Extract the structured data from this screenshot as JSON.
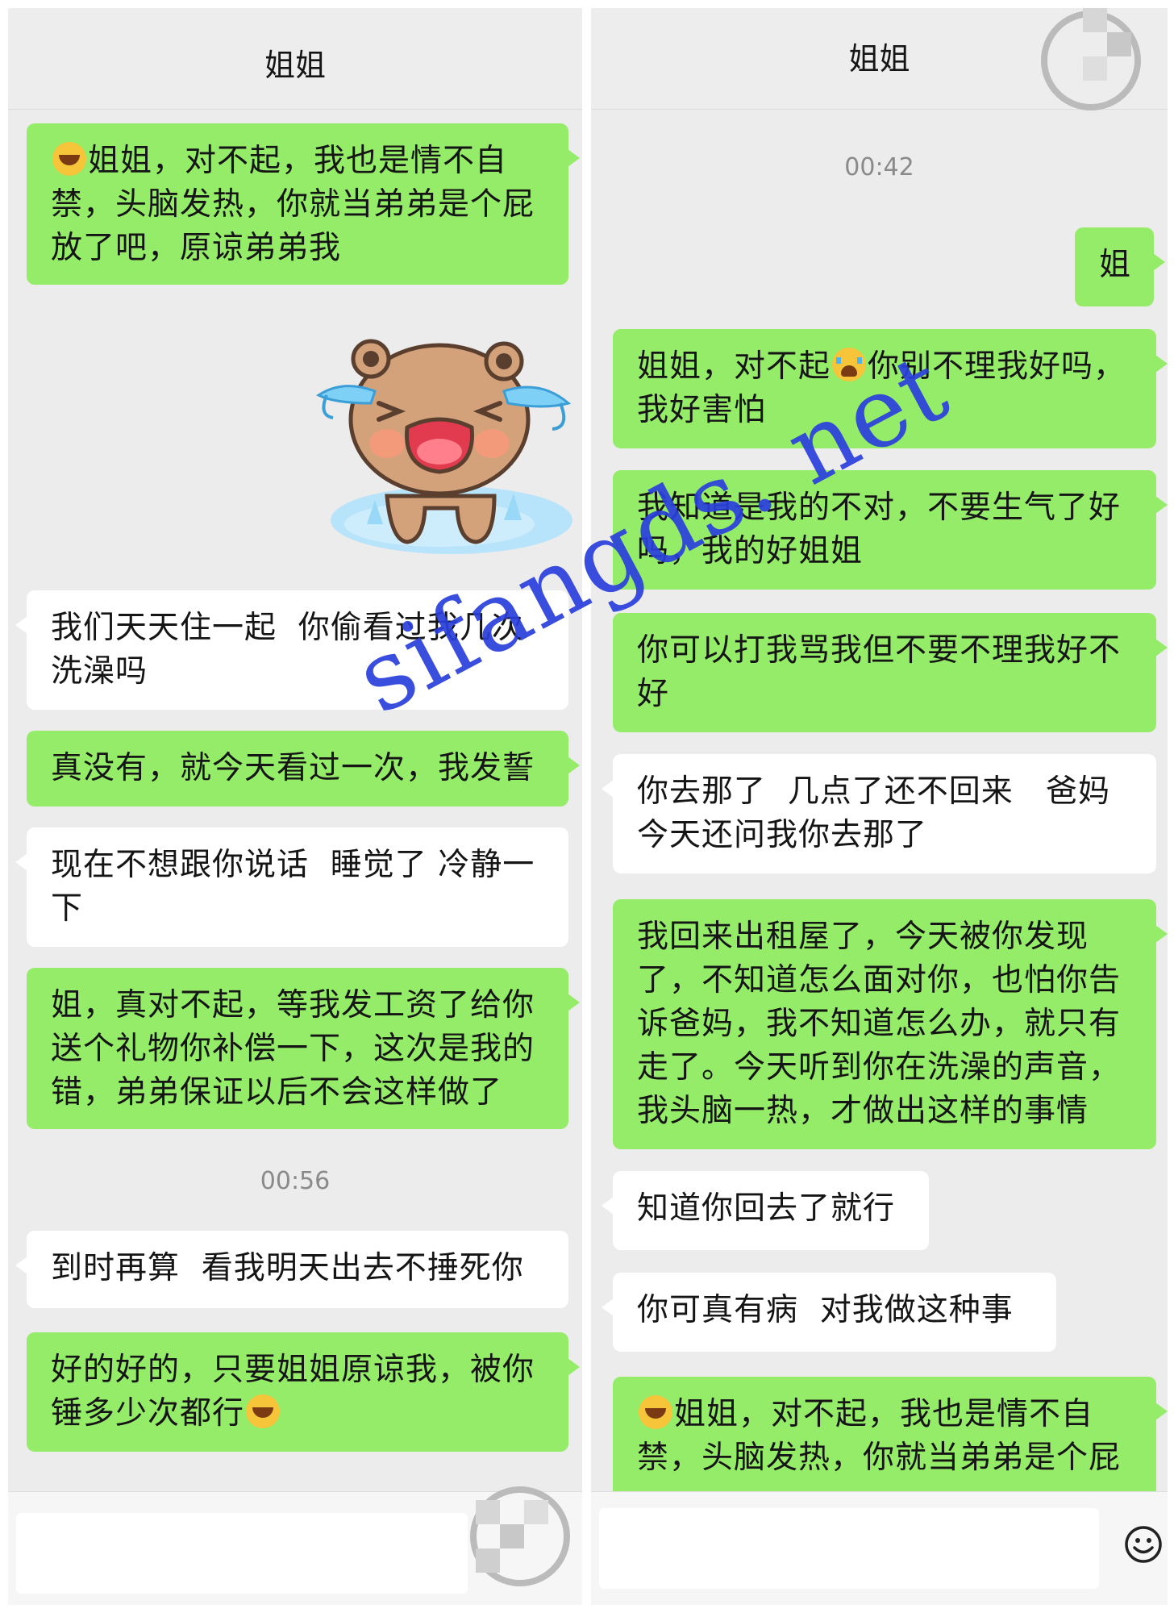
{
  "left": {
    "header_title": "姐姐",
    "messages": [
      {
        "side": "sent",
        "emoji_start": "laugh-cry",
        "text": "姐姐，对不起，我也是情不自\n禁，头脑发热，你就当弟弟是个屁\n放了吧，原谅弟弟我"
      },
      {
        "side": "recv",
        "text": "我们天天住一起  你偷看过我几次\n洗澡吗"
      },
      {
        "side": "sent",
        "text": "真没有，就今天看过一次，我发誓"
      },
      {
        "side": "recv",
        "text": "现在不想跟你说话  睡觉了 冷静一\n下"
      },
      {
        "side": "sent",
        "text": "姐，真对不起，等我发工资了给你\n送个礼物你补偿一下，这次是我的\n错，弟弟保证以后不会这样做了"
      },
      {
        "side": "recv",
        "text": "到时再算  看我明天出去不捶死你"
      },
      {
        "side": "sent",
        "text": "好的好的，只要姐姐原谅我，被你\n锤多少次都行",
        "emoji_end": "laugh-cry"
      }
    ],
    "timestamp": "00:56",
    "sticker": "crying-bear-sticker"
  },
  "right": {
    "header_title": "姐姐",
    "timestamp": "00:42",
    "messages": [
      {
        "side": "sent",
        "text": "姐"
      },
      {
        "side": "sent",
        "text_before": "姐姐，对不起",
        "emoji_mid": "crying",
        "text_after": "你别不理我好吗，\n我好害怕"
      },
      {
        "side": "sent",
        "text": "我知道是我的不对，不要生气了好\n吗，我的好姐姐"
      },
      {
        "side": "sent",
        "text": "你可以打我骂我但不要不理我好不\n好"
      },
      {
        "side": "recv",
        "text": "你去那了  几点了还不回来   爸妈\n今天还问我你去那了"
      },
      {
        "side": "sent",
        "text": "我回来出租屋了，今天被你发现\n了，不知道怎么面对你，也怕你告\n诉爸妈，我不知道怎么办，就只有\n走了。今天听到你在洗澡的声音，\n我头脑一热，才做出这样的事情"
      },
      {
        "side": "recv",
        "text": "知道你回去了就行"
      },
      {
        "side": "recv",
        "text": "你可真有病  对我做这种事"
      },
      {
        "side": "sent",
        "emoji_start": "laugh-cry",
        "text": "姐姐，对不起，我也是情不自\n禁，头脑发热，你就当弟弟是个屁"
      }
    ]
  },
  "watermark_text": "sifangds. net",
  "colors": {
    "sent_bubble": "#95ec69",
    "recv_bubble": "#ffffff",
    "background": "#ececec",
    "watermark": "#2a3fdc"
  }
}
